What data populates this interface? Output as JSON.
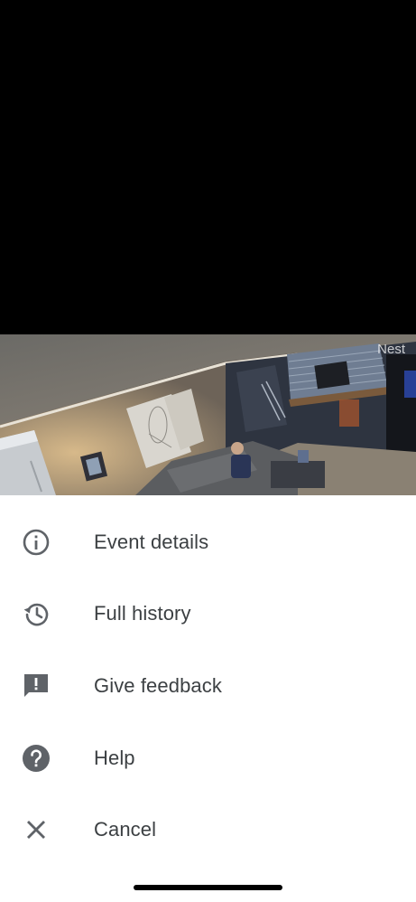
{
  "camera": {
    "watermark": "Nest"
  },
  "menu": {
    "items": [
      {
        "label": "Event details",
        "icon": "info-icon"
      },
      {
        "label": "Full history",
        "icon": "history-icon"
      },
      {
        "label": "Give feedback",
        "icon": "feedback-icon"
      },
      {
        "label": "Help",
        "icon": "help-icon"
      },
      {
        "label": "Cancel",
        "icon": "close-icon"
      }
    ]
  },
  "colors": {
    "text": "#3c4043",
    "icon": "#5f6368",
    "background": "#ffffff"
  }
}
